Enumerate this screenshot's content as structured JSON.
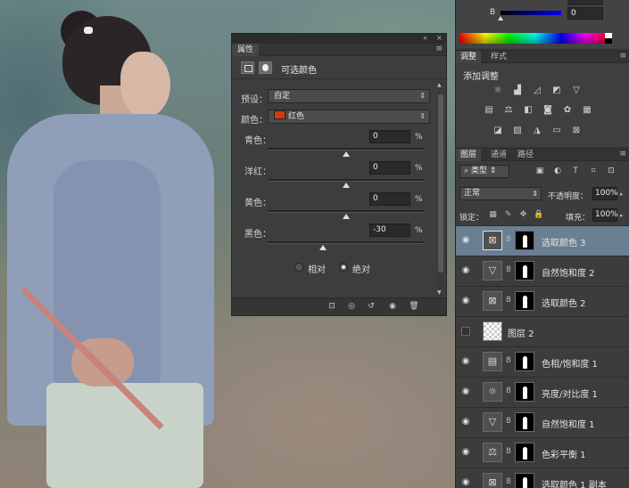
{
  "properties": {
    "tab": "属性",
    "title": "可选颜色",
    "preset_label": "预设：",
    "preset_value": "自定",
    "color_label": "颜色：",
    "color_value": "红色",
    "color_swatch": "#d23a12",
    "channels": [
      {
        "label": "青色：",
        "value": "0",
        "unit": "%",
        "level": 0
      },
      {
        "label": "洋红：",
        "value": "0",
        "unit": "%",
        "level": 0
      },
      {
        "label": "黄色：",
        "value": "0",
        "unit": "%",
        "level": 0
      },
      {
        "label": "黑色：",
        "value": "-30",
        "unit": "%",
        "level": -30
      }
    ],
    "mode_relative": "相对",
    "mode_absolute": "绝对",
    "mode_selected": "绝对"
  },
  "color_panel": {
    "b_label": "B",
    "b_value": "0"
  },
  "adjustments": {
    "tabs": [
      "调整",
      "样式"
    ],
    "active_tab": "调整",
    "title": "添加调整",
    "icons": [
      [
        "brightness-icon",
        "levels-icon",
        "curves-icon",
        "exposure-icon",
        "vibrance-icon"
      ],
      [
        "hue-saturation-icon",
        "color-balance-icon",
        "black-white-icon",
        "photo-filter-icon",
        "channel-mixer-icon",
        "color-lookup-icon"
      ],
      [
        "invert-icon",
        "posterize-icon",
        "threshold-icon",
        "gradient-map-icon",
        "selective-color-icon"
      ]
    ]
  },
  "layers_panel": {
    "tabs": [
      "图层",
      "通道",
      "路径"
    ],
    "active_tab": "图层",
    "filter_value": "类型",
    "blend_mode": "正常",
    "opacity_label": "不透明度：",
    "opacity_value": "100%",
    "lock_label": "锁定：",
    "fill_label": "填充：",
    "fill_value": "100%",
    "layers": [
      {
        "name": "选取颜色 3",
        "icon": "selective-color-icon",
        "visible": true,
        "active": true
      },
      {
        "name": "自然饱和度 2",
        "icon": "vibrance-icon",
        "visible": true,
        "active": false
      },
      {
        "name": "选取颜色 2",
        "icon": "selective-color-icon",
        "visible": true,
        "active": false
      },
      {
        "name": "图层 2",
        "icon": "pixel-layer-icon",
        "visible": false,
        "active": false
      },
      {
        "name": "色相/饱和度 1",
        "icon": "hue-saturation-icon",
        "visible": true,
        "active": false
      },
      {
        "name": "亮度/对比度 1",
        "icon": "brightness-icon",
        "visible": true,
        "active": false
      },
      {
        "name": "自然饱和度 1",
        "icon": "vibrance-icon",
        "visible": true,
        "active": false
      },
      {
        "name": "色彩平衡 1",
        "icon": "color-balance-icon",
        "visible": true,
        "active": false
      },
      {
        "name": "选取颜色 1 副本",
        "icon": "selective-color-icon",
        "visible": true,
        "active": false
      }
    ]
  }
}
